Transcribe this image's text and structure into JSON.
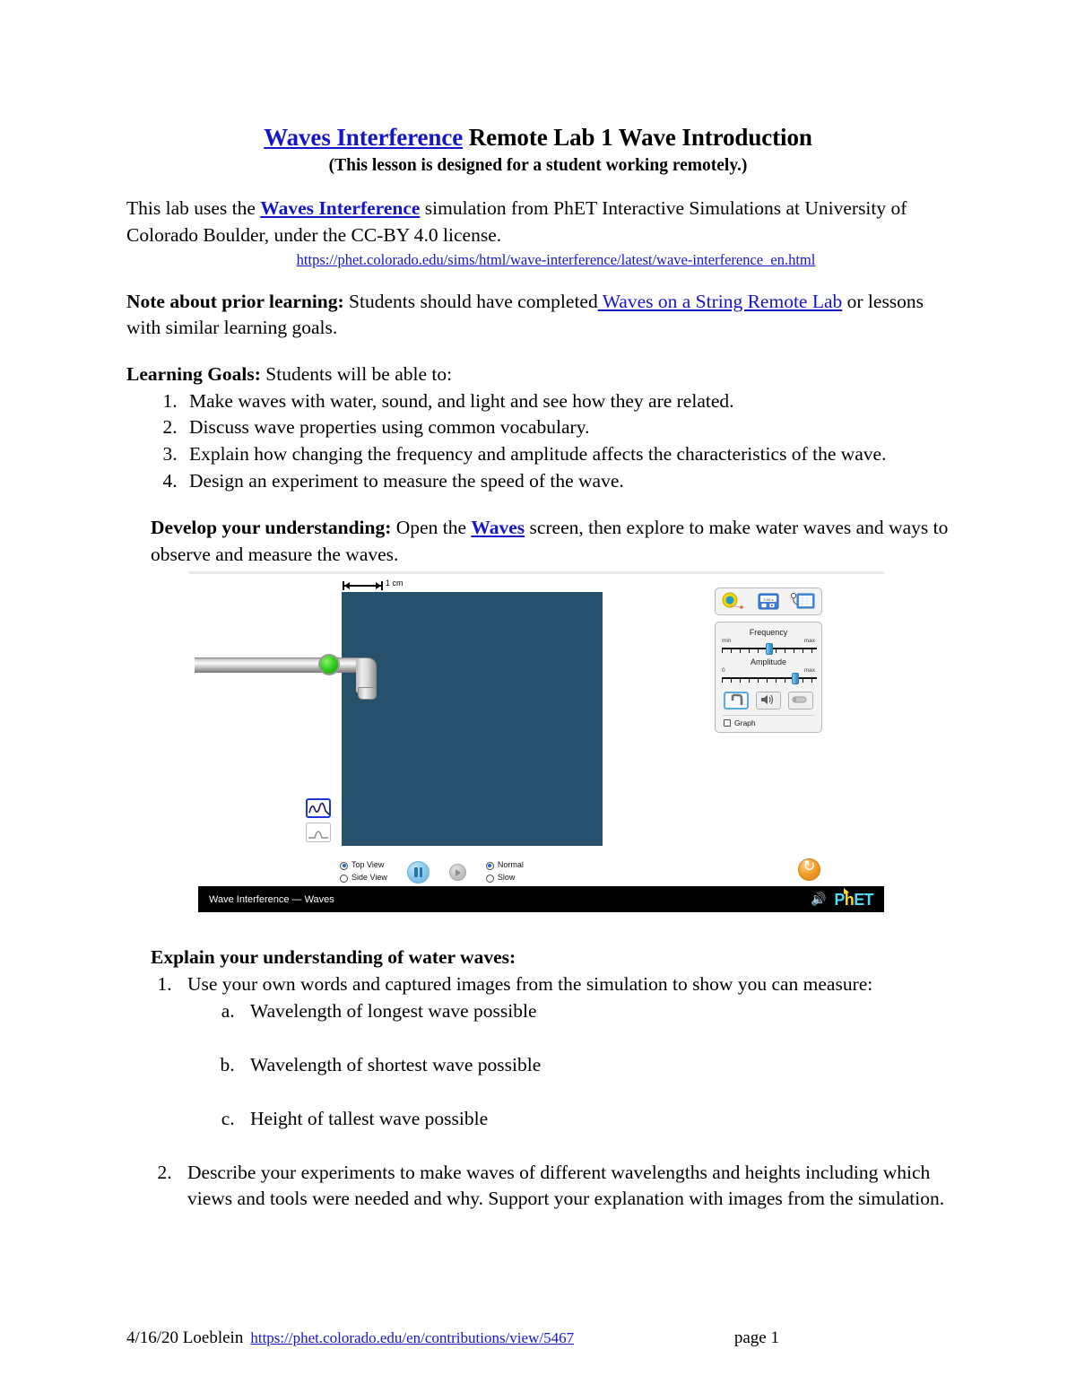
{
  "document": {
    "title_link": "Waves Interference",
    "title_rest": " Remote Lab 1 Wave Introduction",
    "subtitle": "(This lesson is designed for a student working remotely.)",
    "intro_pre": "This lab uses the ",
    "intro_link": "Waves Interference",
    "intro_post": " simulation from PhET Interactive Simulations at University of Colorado Boulder, under the CC-BY 4.0 license.",
    "sim_url": "https://phet.colorado.edu/sims/html/wave-interference/latest/wave-interference_en.html",
    "prior_label": "Note about prior learning:",
    "prior_pre": " Students should have completed",
    "prior_link": " Waves on a String Remote Lab",
    "prior_post": " or lessons with similar learning goals.",
    "goals_label": "Learning Goals:",
    "goals_intro": " Students will be able to:",
    "goals": [
      "Make waves with water, sound, and light and see how they are related.",
      "Discuss wave properties using common vocabulary.",
      "Explain how changing the frequency and amplitude affects the characteristics of the wave.",
      "Design an experiment to measure the speed of the wave."
    ],
    "develop_label": "Develop your understanding:",
    "develop_pre": " Open the ",
    "develop_link": "Waves",
    "develop_post": " screen, then explore to make water waves and ways to observe and measure the waves.",
    "explain_label": "Explain your understanding of water waves:",
    "explain_items": [
      "Use your own words and captured images from the simulation to show you can measure:",
      "Describe your experiments to make waves of different wavelengths and heights including which views and tools were needed and why. Support your explanation with images from the simulation."
    ],
    "explain_sub": [
      "Wavelength of longest wave possible",
      "Wavelength of shortest wave possible",
      "Height of tallest wave possible"
    ],
    "footer_date_author": "4/16/20 Loeblein",
    "footer_link": "https://phet.colorado.edu/en/contributions/view/5467",
    "footer_page": "page 1"
  },
  "simulation": {
    "ruler_label": "1 cm",
    "frequency": {
      "title": "Frequency",
      "min_label": "min",
      "max_label": "max",
      "value_percent": 50
    },
    "amplitude": {
      "title": "Amplitude",
      "min_label": "0",
      "max_label": "max",
      "value_percent": 80
    },
    "graph_checkbox_label": "Graph",
    "view_options": [
      "Top View",
      "Side View"
    ],
    "view_selected": "Top View",
    "speed_options": [
      "Normal",
      "Slow"
    ],
    "speed_selected": "Normal",
    "footer_title": "Wave Interference — Waves",
    "logo_p": "P",
    "logo_h": "h",
    "logo_et": "ET",
    "water_color": "#27506c",
    "accent_blue": "#1c39d8",
    "reset_color": "#f59c2a"
  }
}
